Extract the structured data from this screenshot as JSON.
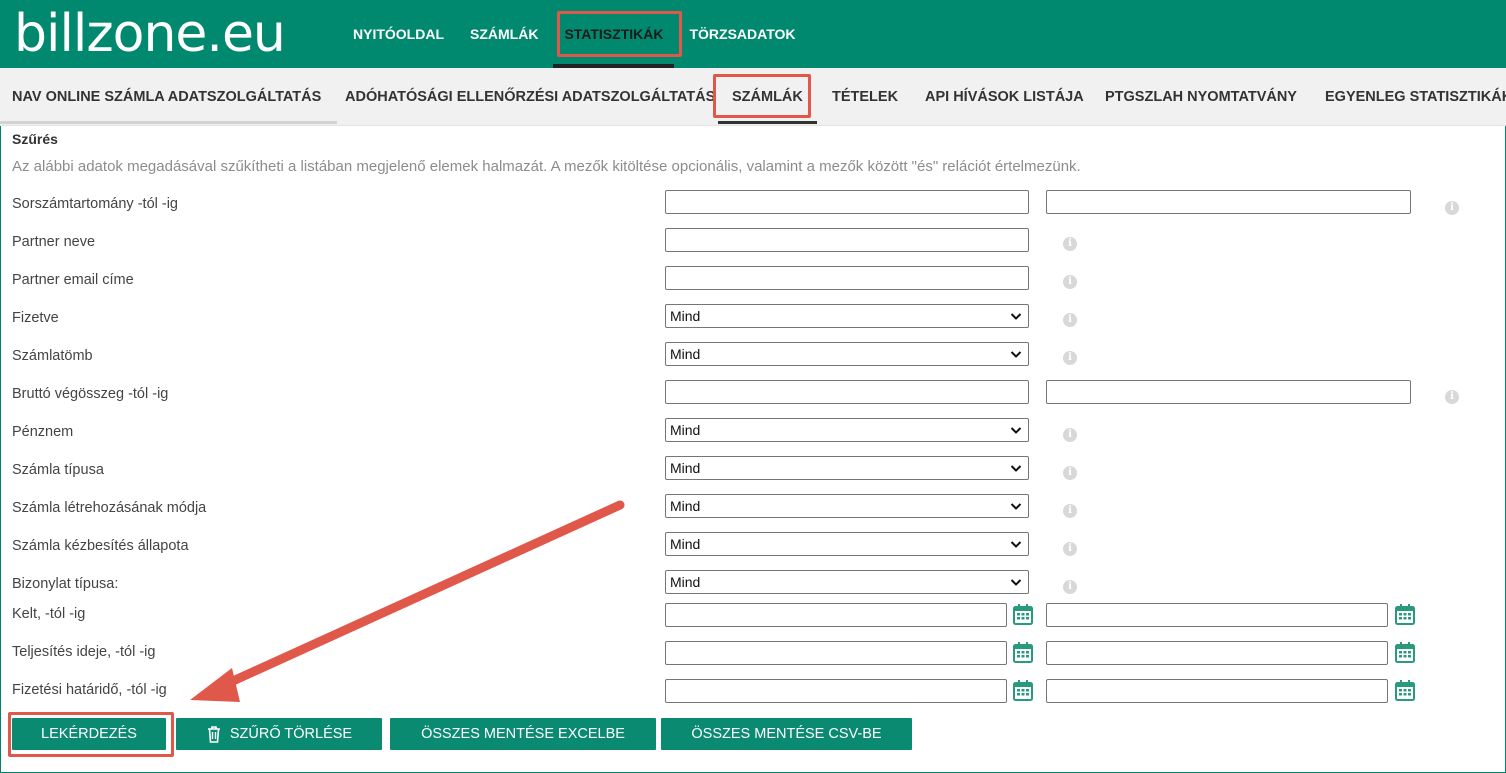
{
  "logo": "billzone.eu",
  "topnav": [
    "NYITÓOLDAL",
    "SZÁMLÁK",
    "STATISZTIKÁK",
    "TÖRZSADATOK"
  ],
  "subnav": [
    "NAV ONLINE SZÁMLA ADATSZOLGÁLTATÁS",
    "ADÓHATÓSÁGI ELLENŐRZÉSI ADATSZOLGÁLTATÁS",
    "SZÁMLÁK",
    "TÉTELEK",
    "API HÍVÁSOK LISTÁJA",
    "PTGSZLAH NYOMTATVÁNY",
    "EGYENLEG STATISZTIKÁK"
  ],
  "filter": {
    "title": "Szűrés",
    "description": "Az alábbi adatok megadásával szűkítheti a listában megjelenő elemek halmazát. A mezők kitöltése opcionális, valamint a mezők között \"és\" relációt értelmezünk.",
    "rows": [
      {
        "label": "Sorszámtartomány -tól -ig",
        "type": "range",
        "from": "",
        "to": ""
      },
      {
        "label": "Partner neve",
        "type": "text",
        "value": ""
      },
      {
        "label": "Partner email címe",
        "type": "text",
        "value": ""
      },
      {
        "label": "Fizetve",
        "type": "select",
        "value": "Mind"
      },
      {
        "label": "Számlatömb",
        "type": "select",
        "value": "Mind"
      },
      {
        "label": "Bruttó végösszeg -tól -ig",
        "type": "range",
        "from": "",
        "to": ""
      },
      {
        "label": "Pénznem",
        "type": "select",
        "value": "Mind"
      },
      {
        "label": "Számla típusa",
        "type": "select",
        "value": "Mind"
      },
      {
        "label": "Számla létrehozásának módja",
        "type": "select",
        "value": "Mind"
      },
      {
        "label": "Számla kézbesítés állapota",
        "type": "select",
        "value": "Mind"
      },
      {
        "label": "Bizonylat típusa:",
        "type": "select",
        "value": "Mind"
      },
      {
        "label": "Kelt, -tól -ig",
        "type": "daterange",
        "from": "",
        "to": ""
      },
      {
        "label": "Teljesítés ideje, -tól -ig",
        "type": "daterange",
        "from": "",
        "to": ""
      },
      {
        "label": "Fizetési határidő, -tól -ig",
        "type": "daterange",
        "from": "",
        "to": ""
      }
    ]
  },
  "buttons": {
    "query": "LEKÉRDEZÉS",
    "clear": "SZŰRŐ TÖRLÉSE",
    "excel": "ÖSSZES MENTÉSE EXCELBE",
    "csv": "ÖSSZES MENTÉSE CSV-BE"
  },
  "icons": {
    "info": "info-icon",
    "calendar": "calendar-icon",
    "trash": "trash-icon",
    "dropdown": "chevron-down-icon"
  },
  "colors": {
    "brand": "#00896f",
    "button": "#0a8a70",
    "highlight": "#e0584a"
  }
}
